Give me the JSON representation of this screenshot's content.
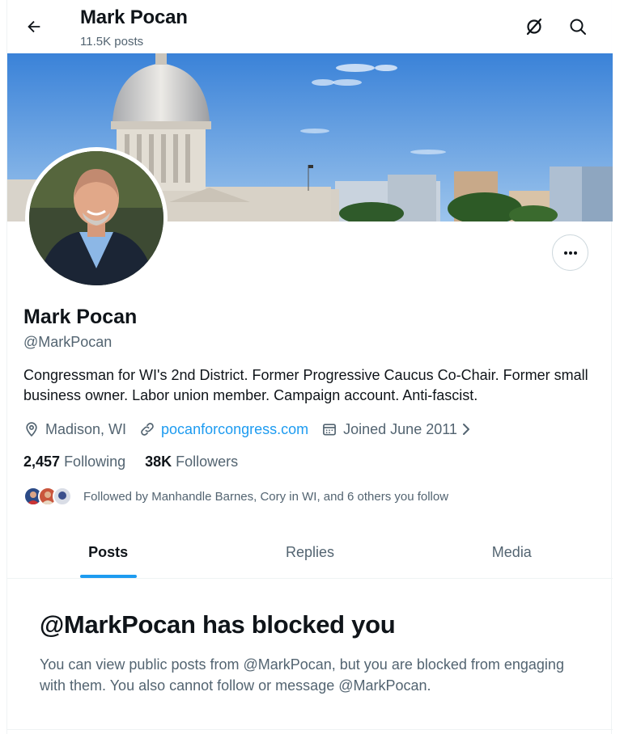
{
  "header": {
    "title": "Mark Pocan",
    "post_count": "11.5K posts"
  },
  "profile": {
    "name": "Mark Pocan",
    "handle": "@MarkPocan",
    "bio": "Congressman for WI's 2nd District. Former Progressive Caucus Co-Chair. Former small business owner. Labor union member. Campaign account. Anti-fascist.",
    "location": "Madison, WI",
    "website": "pocanforcongress.com",
    "joined": "Joined June 2011",
    "following_count": "2,457",
    "following_label": "Following",
    "followers_count": "38K",
    "followers_label": "Followers",
    "followed_by": "Followed by Manhandle Barnes, Cory in WI, and 6 others you follow"
  },
  "tabs": [
    {
      "label": "Posts",
      "active": true
    },
    {
      "label": "Replies",
      "active": false
    },
    {
      "label": "Media",
      "active": false
    }
  ],
  "blocked_notice": {
    "title": "@MarkPocan has blocked you",
    "description": "You can view public posts from @MarkPocan, but you are blocked from engaging with them. You also cannot follow or message @MarkPocan."
  },
  "icons": {
    "back": "arrow-left-icon",
    "grok": "grok-icon",
    "search": "search-icon",
    "more": "more-horizontal-icon",
    "location": "location-pin-icon",
    "link": "link-icon",
    "calendar": "calendar-icon"
  },
  "colors": {
    "accent": "#1d9bf0",
    "text_primary": "#0f1419",
    "text_secondary": "#536471",
    "border": "#eff3f4"
  }
}
